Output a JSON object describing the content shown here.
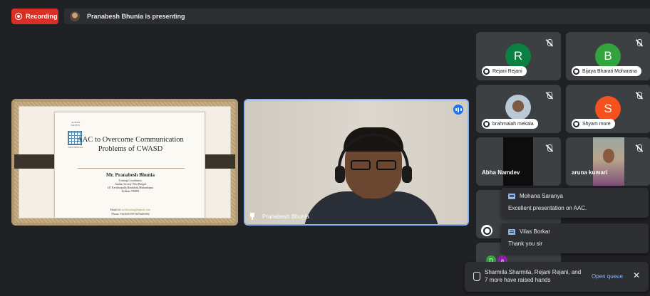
{
  "header": {
    "recording_label": "Recording",
    "presenting_text": "Pranabesh Bhunia is presenting"
  },
  "slide": {
    "logo_top": "AUTISM SOCIETY",
    "logo_bottom": "WEST BENGAL",
    "title_line1": "AAC to Overcome Communication",
    "title_line2": "Problems of CWASD",
    "name": "Mr. Pranabesh Bhunia",
    "role": "Training Coordinator,",
    "org": "Autism Society West Bengal",
    "address1": "147 Kerchirapally,Barabhola,Mukundapur,",
    "address2": "Kolkata 700099",
    "email_label": "Email id:",
    "email_value": "asvbtraining@gmail.com",
    "phone": "Phone: 9123035787/9476483392"
  },
  "speaker": {
    "name": "Pranabesh Bhunia"
  },
  "participants": [
    {
      "name": "Rejani Rejani",
      "initial": "R",
      "color": "#0b8043"
    },
    {
      "name": "Bijaya Bharati Moharana",
      "initial": "B",
      "color": "#33a33d"
    },
    {
      "name": "brahmaiah mekala",
      "initial": "",
      "color": ""
    },
    {
      "name": "Shyam more",
      "initial": "S",
      "color": "#f4511e"
    },
    {
      "name": "Abha Namdev",
      "initial": "",
      "color": ""
    },
    {
      "name": "aruna kumari",
      "initial": "",
      "color": ""
    }
  ],
  "chat": [
    {
      "sender": "Mohana Saranya",
      "message": "Excellent presentation on AAC."
    },
    {
      "sender": "Vilas Borkar",
      "message": "Thank you sir"
    }
  ],
  "partial_avatars": [
    "D",
    "a"
  ],
  "hands": {
    "text": "Sharmila Sharmila, Rejani Rejani, and 7 more have raised hands",
    "open_queue": "Open queue",
    "close": "✕"
  }
}
